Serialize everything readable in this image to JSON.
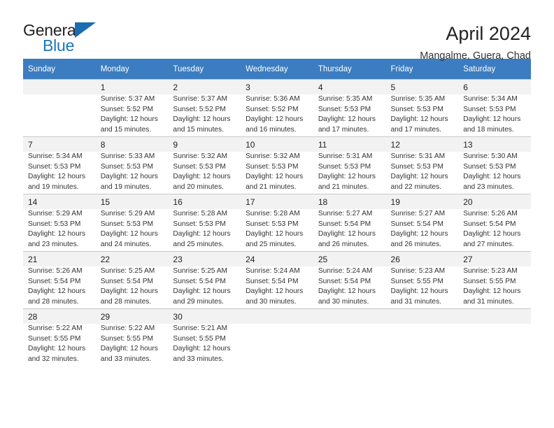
{
  "brand": {
    "name_top": "General",
    "name_bottom": "Blue",
    "triangle_icon": "triangle-icon",
    "colors": {
      "dark": "#231f20",
      "blue": "#1b75bb",
      "header_blue": "#3b7dc0"
    }
  },
  "header": {
    "title": "April 2024",
    "subtitle": "Mangalme, Guera, Chad"
  },
  "calendar": {
    "weekdays": [
      "Sunday",
      "Monday",
      "Tuesday",
      "Wednesday",
      "Thursday",
      "Friday",
      "Saturday"
    ],
    "weeks": [
      [
        {
          "day": "",
          "sunrise": "",
          "sunset": "",
          "daylight": ""
        },
        {
          "day": "1",
          "sunrise": "Sunrise: 5:37 AM",
          "sunset": "Sunset: 5:52 PM",
          "daylight": "Daylight: 12 hours and 15 minutes."
        },
        {
          "day": "2",
          "sunrise": "Sunrise: 5:37 AM",
          "sunset": "Sunset: 5:52 PM",
          "daylight": "Daylight: 12 hours and 15 minutes."
        },
        {
          "day": "3",
          "sunrise": "Sunrise: 5:36 AM",
          "sunset": "Sunset: 5:52 PM",
          "daylight": "Daylight: 12 hours and 16 minutes."
        },
        {
          "day": "4",
          "sunrise": "Sunrise: 5:35 AM",
          "sunset": "Sunset: 5:53 PM",
          "daylight": "Daylight: 12 hours and 17 minutes."
        },
        {
          "day": "5",
          "sunrise": "Sunrise: 5:35 AM",
          "sunset": "Sunset: 5:53 PM",
          "daylight": "Daylight: 12 hours and 17 minutes."
        },
        {
          "day": "6",
          "sunrise": "Sunrise: 5:34 AM",
          "sunset": "Sunset: 5:53 PM",
          "daylight": "Daylight: 12 hours and 18 minutes."
        }
      ],
      [
        {
          "day": "7",
          "sunrise": "Sunrise: 5:34 AM",
          "sunset": "Sunset: 5:53 PM",
          "daylight": "Daylight: 12 hours and 19 minutes."
        },
        {
          "day": "8",
          "sunrise": "Sunrise: 5:33 AM",
          "sunset": "Sunset: 5:53 PM",
          "daylight": "Daylight: 12 hours and 19 minutes."
        },
        {
          "day": "9",
          "sunrise": "Sunrise: 5:32 AM",
          "sunset": "Sunset: 5:53 PM",
          "daylight": "Daylight: 12 hours and 20 minutes."
        },
        {
          "day": "10",
          "sunrise": "Sunrise: 5:32 AM",
          "sunset": "Sunset: 5:53 PM",
          "daylight": "Daylight: 12 hours and 21 minutes."
        },
        {
          "day": "11",
          "sunrise": "Sunrise: 5:31 AM",
          "sunset": "Sunset: 5:53 PM",
          "daylight": "Daylight: 12 hours and 21 minutes."
        },
        {
          "day": "12",
          "sunrise": "Sunrise: 5:31 AM",
          "sunset": "Sunset: 5:53 PM",
          "daylight": "Daylight: 12 hours and 22 minutes."
        },
        {
          "day": "13",
          "sunrise": "Sunrise: 5:30 AM",
          "sunset": "Sunset: 5:53 PM",
          "daylight": "Daylight: 12 hours and 23 minutes."
        }
      ],
      [
        {
          "day": "14",
          "sunrise": "Sunrise: 5:29 AM",
          "sunset": "Sunset: 5:53 PM",
          "daylight": "Daylight: 12 hours and 23 minutes."
        },
        {
          "day": "15",
          "sunrise": "Sunrise: 5:29 AM",
          "sunset": "Sunset: 5:53 PM",
          "daylight": "Daylight: 12 hours and 24 minutes."
        },
        {
          "day": "16",
          "sunrise": "Sunrise: 5:28 AM",
          "sunset": "Sunset: 5:53 PM",
          "daylight": "Daylight: 12 hours and 25 minutes."
        },
        {
          "day": "17",
          "sunrise": "Sunrise: 5:28 AM",
          "sunset": "Sunset: 5:53 PM",
          "daylight": "Daylight: 12 hours and 25 minutes."
        },
        {
          "day": "18",
          "sunrise": "Sunrise: 5:27 AM",
          "sunset": "Sunset: 5:54 PM",
          "daylight": "Daylight: 12 hours and 26 minutes."
        },
        {
          "day": "19",
          "sunrise": "Sunrise: 5:27 AM",
          "sunset": "Sunset: 5:54 PM",
          "daylight": "Daylight: 12 hours and 26 minutes."
        },
        {
          "day": "20",
          "sunrise": "Sunrise: 5:26 AM",
          "sunset": "Sunset: 5:54 PM",
          "daylight": "Daylight: 12 hours and 27 minutes."
        }
      ],
      [
        {
          "day": "21",
          "sunrise": "Sunrise: 5:26 AM",
          "sunset": "Sunset: 5:54 PM",
          "daylight": "Daylight: 12 hours and 28 minutes."
        },
        {
          "day": "22",
          "sunrise": "Sunrise: 5:25 AM",
          "sunset": "Sunset: 5:54 PM",
          "daylight": "Daylight: 12 hours and 28 minutes."
        },
        {
          "day": "23",
          "sunrise": "Sunrise: 5:25 AM",
          "sunset": "Sunset: 5:54 PM",
          "daylight": "Daylight: 12 hours and 29 minutes."
        },
        {
          "day": "24",
          "sunrise": "Sunrise: 5:24 AM",
          "sunset": "Sunset: 5:54 PM",
          "daylight": "Daylight: 12 hours and 30 minutes."
        },
        {
          "day": "25",
          "sunrise": "Sunrise: 5:24 AM",
          "sunset": "Sunset: 5:54 PM",
          "daylight": "Daylight: 12 hours and 30 minutes."
        },
        {
          "day": "26",
          "sunrise": "Sunrise: 5:23 AM",
          "sunset": "Sunset: 5:55 PM",
          "daylight": "Daylight: 12 hours and 31 minutes."
        },
        {
          "day": "27",
          "sunrise": "Sunrise: 5:23 AM",
          "sunset": "Sunset: 5:55 PM",
          "daylight": "Daylight: 12 hours and 31 minutes."
        }
      ],
      [
        {
          "day": "28",
          "sunrise": "Sunrise: 5:22 AM",
          "sunset": "Sunset: 5:55 PM",
          "daylight": "Daylight: 12 hours and 32 minutes."
        },
        {
          "day": "29",
          "sunrise": "Sunrise: 5:22 AM",
          "sunset": "Sunset: 5:55 PM",
          "daylight": "Daylight: 12 hours and 33 minutes."
        },
        {
          "day": "30",
          "sunrise": "Sunrise: 5:21 AM",
          "sunset": "Sunset: 5:55 PM",
          "daylight": "Daylight: 12 hours and 33 minutes."
        },
        {
          "day": "",
          "sunrise": "",
          "sunset": "",
          "daylight": ""
        },
        {
          "day": "",
          "sunrise": "",
          "sunset": "",
          "daylight": ""
        },
        {
          "day": "",
          "sunrise": "",
          "sunset": "",
          "daylight": ""
        },
        {
          "day": "",
          "sunrise": "",
          "sunset": "",
          "daylight": ""
        }
      ]
    ]
  }
}
